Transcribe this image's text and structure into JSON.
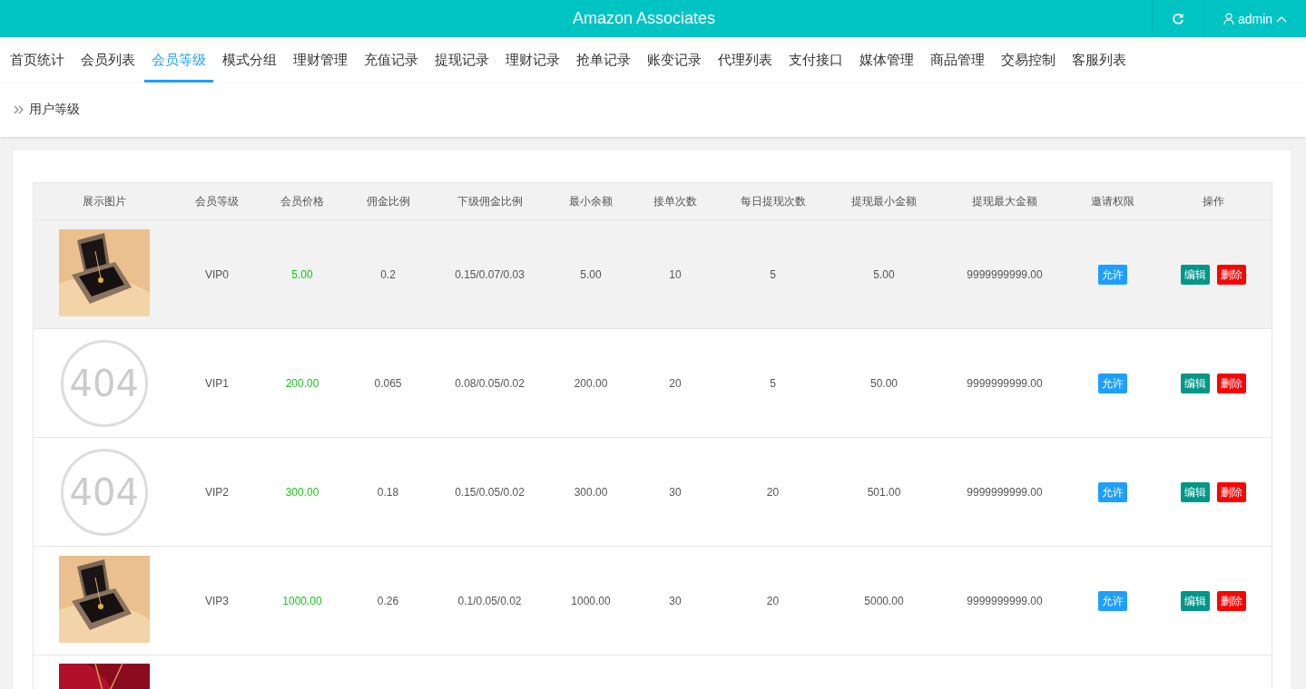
{
  "header": {
    "title": "Amazon Associates",
    "user": "admin"
  },
  "tabs": [
    {
      "label": "首页统计",
      "selected": false
    },
    {
      "label": "会员列表",
      "selected": false
    },
    {
      "label": "会员等级",
      "selected": true
    },
    {
      "label": "模式分组",
      "selected": false
    },
    {
      "label": "理财管理",
      "selected": false
    },
    {
      "label": "充值记录",
      "selected": false
    },
    {
      "label": "提现记录",
      "selected": false
    },
    {
      "label": "理财记录",
      "selected": false
    },
    {
      "label": "抢单记录",
      "selected": false
    },
    {
      "label": "账变记录",
      "selected": false
    },
    {
      "label": "代理列表",
      "selected": false
    },
    {
      "label": "支付接口",
      "selected": false
    },
    {
      "label": "媒体管理",
      "selected": false
    },
    {
      "label": "商品管理",
      "selected": false
    },
    {
      "label": "交易控制",
      "selected": false
    },
    {
      "label": "客服列表",
      "selected": false
    }
  ],
  "breadcrumb": "用户等级",
  "table": {
    "columns": [
      "展示图片",
      "会员等级",
      "会员价格",
      "佣金比例",
      "下级佣金比例",
      "最小余额",
      "接单次数",
      "每日提现次数",
      "提现最小金额",
      "提现最大金额",
      "邀请权限",
      "操作"
    ],
    "rows": [
      {
        "highlighted": true,
        "level": "VIP0",
        "price": "5.00",
        "commission": "0.2",
        "sub_commission": "0.15/0.07/0.03",
        "min_balance": "5.00",
        "orders": "10",
        "daily_withdrawals": "5",
        "withdraw_min": "5.00",
        "withdraw_max": "9999999999.00",
        "invite": "允许",
        "actions": [
          "编辑",
          "删除"
        ]
      },
      {
        "image": {
          "kind": "missing",
          "text": "404"
        },
        "highlighted": false,
        "level": "VIP1",
        "price": "200.00",
        "commission": "0.065",
        "sub_commission": "0.08/0.05/0.02",
        "min_balance": "200.00",
        "orders": "20",
        "daily_withdrawals": "5",
        "withdraw_min": "50.00",
        "withdraw_max": "9999999999.00",
        "invite": "允许",
        "actions": [
          "编辑",
          "删除"
        ]
      },
      {
        "image": {
          "kind": "missing",
          "text": "404"
        },
        "highlighted": false,
        "level": "VIP2",
        "price": "300.00",
        "commission": "0.18",
        "sub_commission": "0.15/0.05/0.02",
        "min_balance": "300.00",
        "orders": "30",
        "daily_withdrawals": "20",
        "withdraw_min": "501.00",
        "withdraw_max": "9999999999.00",
        "invite": "允许",
        "actions": [
          "编辑",
          "删除"
        ]
      },
      {
        "highlighted": false,
        "level": "VIP3",
        "price": "1000.00",
        "commission": "0.26",
        "sub_commission": "0.1/0.05/0.02",
        "min_balance": "1000.00",
        "orders": "30",
        "daily_withdrawals": "20",
        "withdraw_min": "5000.00",
        "withdraw_max": "9999999999.00",
        "invite": "允许",
        "actions": [
          "编辑",
          "删除"
        ]
      },
      {
        "highlighted": false
      }
    ]
  }
}
